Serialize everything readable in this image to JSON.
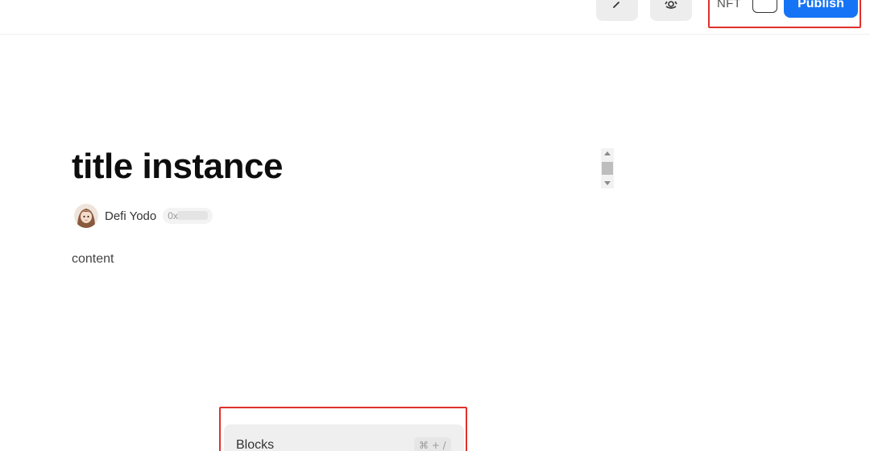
{
  "toolbar": {
    "back_icon": "chevron-left-icon",
    "settings_icon": "gear-icon",
    "nft_label": "NFT",
    "publish_label": "Publish",
    "accent_color": "#1574f6"
  },
  "post": {
    "title": "title instance",
    "author_name": "Defi Yodo",
    "address_prefix": "0x",
    "content": "content"
  },
  "block_menu": {
    "item_label": "Blocks",
    "shortcut": "⌘ + /"
  }
}
